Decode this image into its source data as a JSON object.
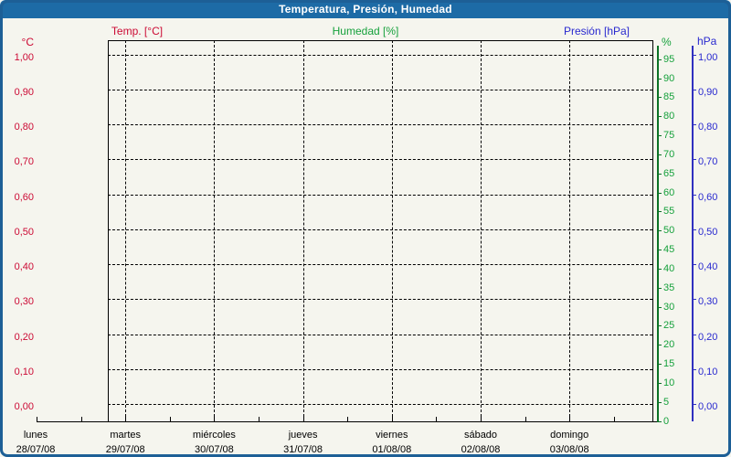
{
  "window": {
    "title": "Temperatura, Presión, Humedad"
  },
  "legend": {
    "temp": "Temp. [°C]",
    "humidity": "Humedad [%]",
    "pressure": "Presión [hPa]"
  },
  "axes": {
    "temp": {
      "unit": "°C",
      "ticks": [
        "1,00",
        "0,90",
        "0,80",
        "0,70",
        "0,60",
        "0,50",
        "0,40",
        "0,30",
        "0,20",
        "0,10",
        "0,00"
      ]
    },
    "humidity": {
      "unit": "%",
      "ticks": [
        "95",
        "90",
        "85",
        "80",
        "75",
        "70",
        "65",
        "60",
        "55",
        "50",
        "45",
        "40",
        "35",
        "30",
        "25",
        "20",
        "15",
        "10",
        "5",
        "0"
      ]
    },
    "pressure": {
      "unit": "hPa",
      "ticks": [
        "1,00",
        "0,90",
        "0,80",
        "0,70",
        "0,60",
        "0,50",
        "0,40",
        "0,30",
        "0,20",
        "0,10",
        "0,00"
      ]
    },
    "x": {
      "days": [
        {
          "name": "lunes",
          "date": "28/07/08"
        },
        {
          "name": "martes",
          "date": "29/07/08"
        },
        {
          "name": "miércoles",
          "date": "30/07/08"
        },
        {
          "name": "jueves",
          "date": "31/07/08"
        },
        {
          "name": "viernes",
          "date": "01/08/08"
        },
        {
          "name": "sábado",
          "date": "02/08/08"
        },
        {
          "name": "domingo",
          "date": "03/08/08"
        }
      ]
    }
  },
  "colors": {
    "titlebar": "#1d6ba6",
    "window_border": "#1d5f96",
    "background": "#f5f5ee",
    "temp": "#cc0a34",
    "humidity": "#16a13c",
    "humidity_axis_line": "#0b7226",
    "pressure": "#2828cf",
    "pressure_axis_line": "#3030c0",
    "grid": "#000000"
  },
  "chart_data": {
    "type": "line",
    "title": "Temperatura, Presión, Humedad",
    "x": {
      "categories": [
        "28/07/08",
        "29/07/08",
        "30/07/08",
        "31/07/08",
        "01/08/08",
        "02/08/08",
        "03/08/08"
      ],
      "day_names": [
        "lunes",
        "martes",
        "miércoles",
        "jueves",
        "viernes",
        "sábado",
        "domingo"
      ]
    },
    "y_axes": [
      {
        "id": "temp",
        "label": "Temp. [°C]",
        "side": "left",
        "range": [
          0.0,
          1.0
        ],
        "tick_step": 0.1,
        "tick_format": "comma-decimal",
        "color": "#cc0a34"
      },
      {
        "id": "humidity",
        "label": "Humedad [%]",
        "side": "right",
        "range": [
          0,
          100
        ],
        "tick_step": 5,
        "color": "#16a13c"
      },
      {
        "id": "pressure",
        "label": "Presión [hPa]",
        "side": "right",
        "range": [
          0.0,
          1.0
        ],
        "tick_step": 0.1,
        "tick_format": "comma-decimal",
        "color": "#2828cf"
      }
    ],
    "series": [
      {
        "name": "Temp. [°C]",
        "values": []
      },
      {
        "name": "Humedad [%]",
        "values": []
      },
      {
        "name": "Presión [hPa]",
        "values": []
      }
    ],
    "grid": "dashed",
    "legend_position": "top"
  }
}
